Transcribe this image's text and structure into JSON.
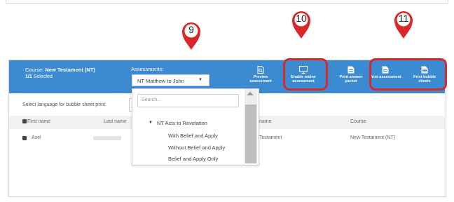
{
  "course": {
    "label": "Course:",
    "name": "New Testament (NT)",
    "selected_count": "1/1",
    "selected_label": "Selected"
  },
  "assessments": {
    "label": "Assessments:",
    "selected": "NT Matthew to John"
  },
  "toolbar": {
    "preview": "Preview assessment",
    "enable_online": "Enable online assessment",
    "print_answer": "Print answer packet",
    "print_assessment": "Print assessment",
    "print_bubble": "Print bubble sheets"
  },
  "callouts": [
    "9",
    "10",
    "11"
  ],
  "language_label": "Select language for bubble sheet print:",
  "table": {
    "headers": {
      "first": "First name",
      "last": "Last name",
      "assessment": "name",
      "course": "Course"
    },
    "row": {
      "first": "Axel",
      "assessment": "Testament",
      "course": "New Testament (NT)"
    }
  },
  "dropdown_menu": {
    "search_placeholder": "Search...",
    "group": "NT Acts to Revelation",
    "items": [
      "With Belief and Apply",
      "Without Belief and Apply",
      "Belief and Apply Only"
    ]
  },
  "colors": {
    "header_blue": "#3c8ad0",
    "callout_red": "#d8282a"
  }
}
